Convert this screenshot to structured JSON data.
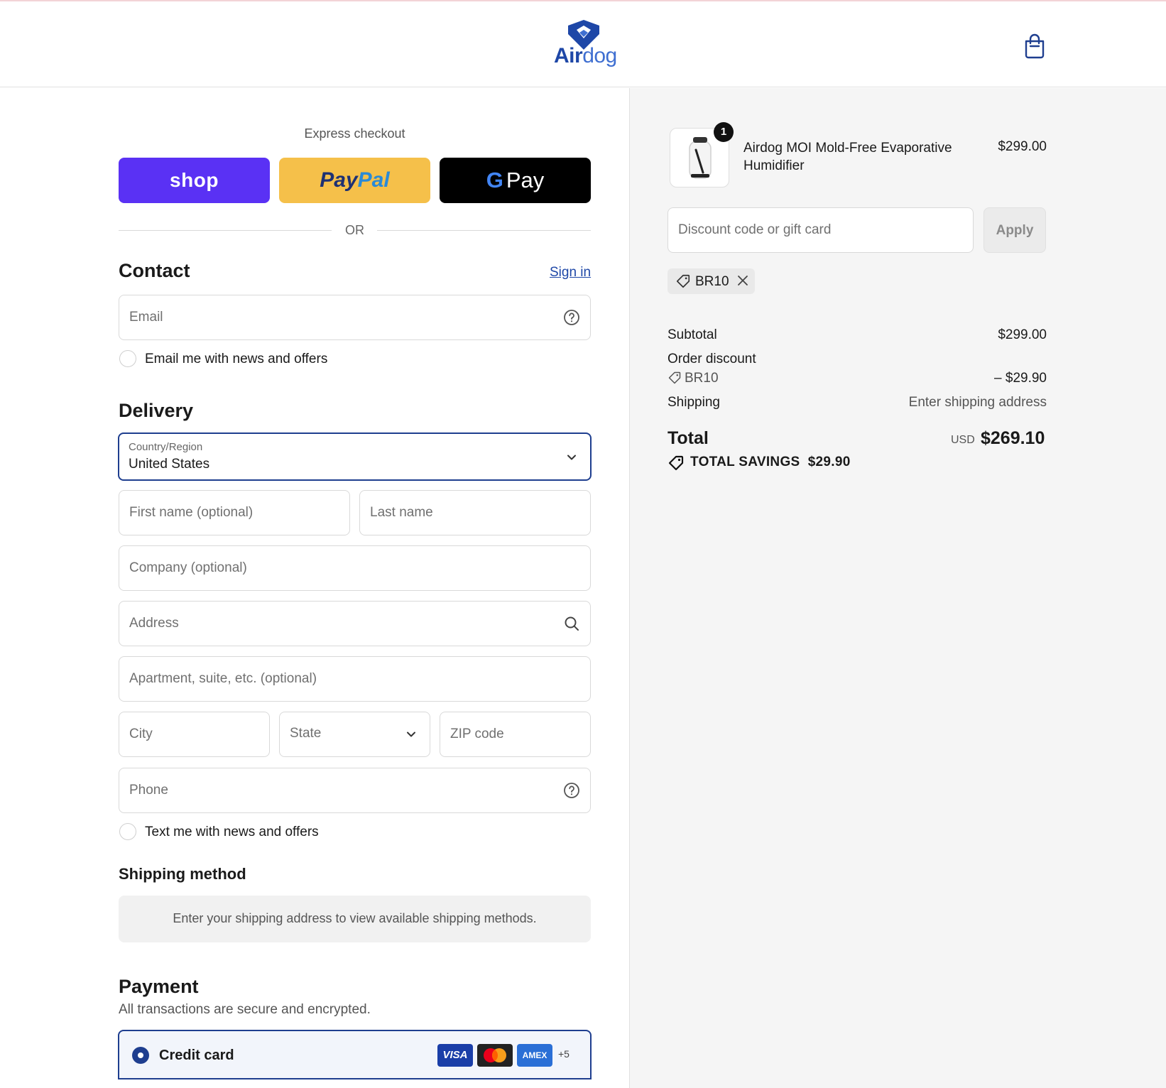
{
  "brand": {
    "name_bold": "Air",
    "name_light": "dog",
    "color": "#1e47a7"
  },
  "express": {
    "label": "Express checkout",
    "shop_label": "shop",
    "paypal_label_1": "Pay",
    "paypal_label_2": "Pal",
    "gpay_g": "G",
    "gpay_label": "Pay",
    "or": "OR"
  },
  "contact": {
    "title": "Contact",
    "sign_in": "Sign in",
    "email_placeholder": "Email",
    "email_news": "Email me with news and offers"
  },
  "delivery": {
    "title": "Delivery",
    "country_label": "Country/Region",
    "country_value": "United States",
    "first_name": "First name (optional)",
    "last_name": "Last name",
    "company": "Company (optional)",
    "address": "Address",
    "apartment": "Apartment, suite, etc. (optional)",
    "city": "City",
    "state": "State",
    "zip": "ZIP code",
    "phone": "Phone",
    "text_news": "Text me with news and offers"
  },
  "shipping_method": {
    "title": "Shipping method",
    "info": "Enter your shipping address to view available shipping methods."
  },
  "payment": {
    "title": "Payment",
    "subtitle": "All transactions are secure and encrypted.",
    "credit_card": "Credit card",
    "visa": "VISA",
    "amex": "AMEX",
    "more": "+5"
  },
  "summary": {
    "product_name": "Airdog MOI Mold-Free Evaporative Humidifier",
    "product_price": "$299.00",
    "quantity": "1",
    "discount_placeholder": "Discount code or gift card",
    "apply": "Apply",
    "code": "BR10",
    "subtotal_label": "Subtotal",
    "subtotal_value": "$299.00",
    "order_discount_label": "Order discount",
    "discount_code": "BR10",
    "discount_value": "– $29.90",
    "shipping_label": "Shipping",
    "shipping_value": "Enter shipping address",
    "total_label": "Total",
    "currency": "USD",
    "total_value": "$269.10",
    "savings_label": "TOTAL SAVINGS",
    "savings_value": "$29.90"
  },
  "colors": {
    "accent": "#1e3e8f",
    "shop": "#5a31f4",
    "paypal": "#f5c04a",
    "gpay": "#000000"
  }
}
